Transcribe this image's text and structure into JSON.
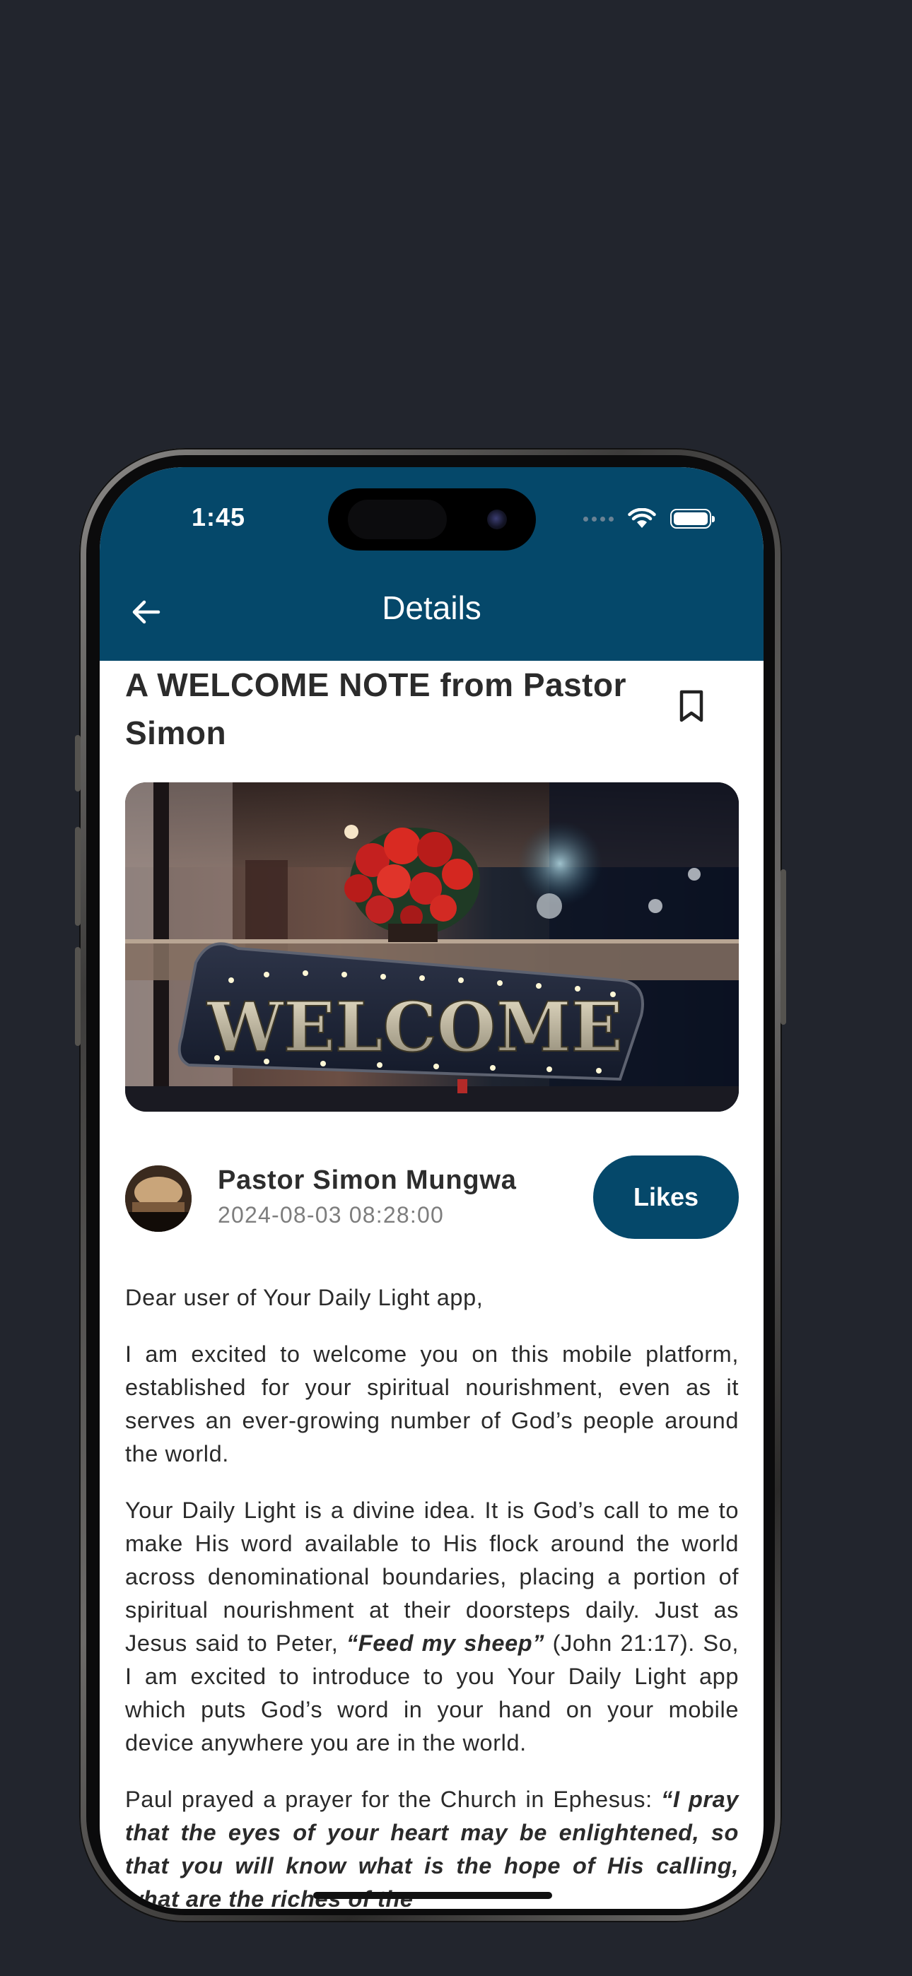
{
  "status_bar": {
    "time": "1:45"
  },
  "appbar": {
    "title": "Details"
  },
  "post": {
    "title": "A WELCOME NOTE from Pastor Simon",
    "hero_text": "WELCOME",
    "author_name": "Pastor Simon Mungwa",
    "date": "2024-08-03 08:28:00",
    "likes_label": "Likes",
    "paragraphs": {
      "p1": "Dear user of Your Daily Light app,",
      "p2": "I am excited to welcome you on this mobile platform, established for your spiritual nourishment, even as it serves an ever-growing number of God’s people around the world.",
      "p3a": "Your Daily Light is a divine idea. It is God’s call to me to make His word available to His flock around the world across denominational boundaries, placing a portion of spiritual nourishment at their doorsteps daily. Just as Jesus said to Peter, ",
      "p3b": "“Feed my sheep”",
      "p3c": " (John 21:17). So, I am excited to introduce to you Your Daily Light app which puts God’s word in your hand on your mobile device anywhere you are in the world.",
      "p4a": "Paul prayed a prayer for the Church in Ephesus: ",
      "p4b": "“I pray that the eyes of your heart may be enlightened, so that you will know what is the hope of His calling, what are the riches of the"
    }
  },
  "colors": {
    "primary": "#05486a",
    "background": "#22252d"
  }
}
